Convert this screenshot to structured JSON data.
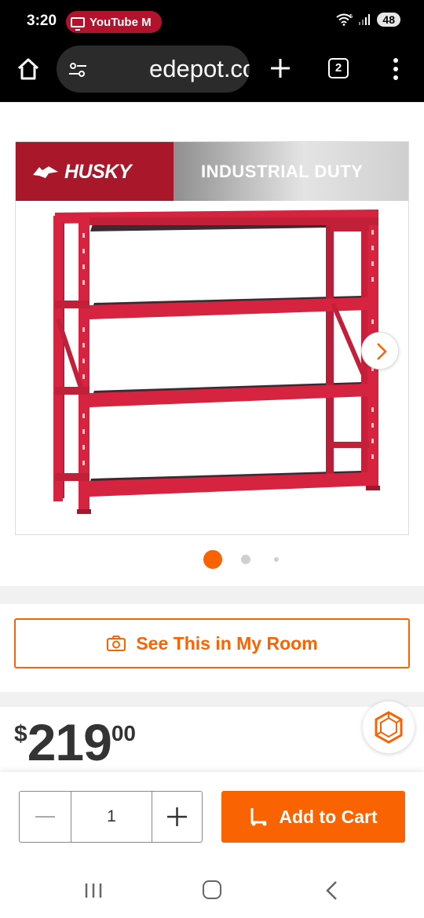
{
  "status_bar": {
    "time": "3:20",
    "notification": "YouTube M",
    "battery": "48",
    "icons": [
      "tv-icon",
      "wifi-icon",
      "signal-icon",
      "battery-icon"
    ]
  },
  "browser": {
    "url": "edepot.com",
    "tab_count": "2",
    "icons": [
      "home-icon",
      "site-settings-icon",
      "new-tab-icon",
      "tabs-icon",
      "more-icon"
    ]
  },
  "product_image": {
    "brand": "HUSKY",
    "banner_text": "INDUSTRIAL DUTY",
    "product_color": "#d6233f",
    "carousel": {
      "total": 3,
      "active": 1
    }
  },
  "actions": {
    "see_room_label": "See This in My Room"
  },
  "price": {
    "currency": "$",
    "dollars": "219",
    "cents": "00"
  },
  "cart": {
    "quantity": "1",
    "add_label": "Add to Cart"
  },
  "colors": {
    "accent": "#f96302",
    "brand_red": "#a8172a"
  }
}
